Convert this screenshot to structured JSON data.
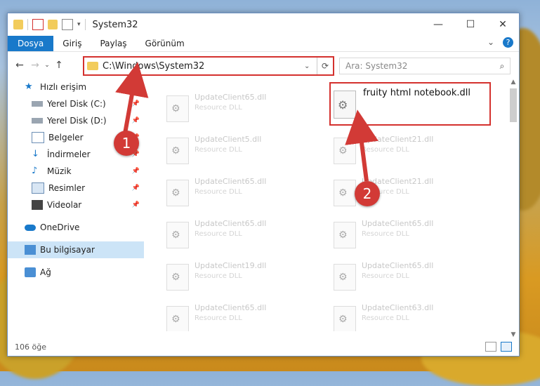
{
  "window": {
    "title": "System32",
    "controls": {
      "minimize": "—",
      "maximize": "☐",
      "close": "✕"
    }
  },
  "ribbon": {
    "file_tab": "Dosya",
    "tabs": [
      "Giriş",
      "Paylaş",
      "Görünüm"
    ],
    "expand": "⌄",
    "help": "?"
  },
  "nav": {
    "back": "←",
    "forward": "→",
    "recent": "⌄",
    "up": "↑",
    "address": "C:\\Windows\\System32",
    "address_drop": "⌄",
    "refresh": "⟳",
    "search_placeholder": "Ara: System32",
    "search_icon": "⌕"
  },
  "sidebar": {
    "items": [
      {
        "label": "Hızlı erişim",
        "icon": "star-icon",
        "pinned": false
      },
      {
        "label": "Yerel Disk (C:)",
        "icon": "drive-icon",
        "pinned": true
      },
      {
        "label": "Yerel Disk (D:)",
        "icon": "drive-icon",
        "pinned": true
      },
      {
        "label": "Belgeler",
        "icon": "document-icon",
        "pinned": true
      },
      {
        "label": "İndirmeler",
        "icon": "download-icon",
        "pinned": true
      },
      {
        "label": "Müzik",
        "icon": "music-icon",
        "pinned": true
      },
      {
        "label": "Resimler",
        "icon": "pictures-icon",
        "pinned": true
      },
      {
        "label": "Videolar",
        "icon": "video-icon",
        "pinned": true
      },
      {
        "label": "OneDrive",
        "icon": "cloud-icon",
        "pinned": false
      },
      {
        "label": "Bu bilgisayar",
        "icon": "computer-icon",
        "pinned": false,
        "selected": true
      },
      {
        "label": "Ağ",
        "icon": "network-icon",
        "pinned": false
      }
    ],
    "pin_glyph": "📌"
  },
  "files": {
    "left_column": [
      {
        "name": "UpdateClient65.dll",
        "type": "Resource DLL"
      },
      {
        "name": "UpdateClient5.dll",
        "type": "Resource DLL"
      },
      {
        "name": "UpdateClient65.dll",
        "type": "Resource DLL"
      },
      {
        "name": "UpdateClient65.dll",
        "type": "Resource DLL"
      },
      {
        "name": "UpdateClient19.dll",
        "type": "Resource DLL"
      },
      {
        "name": "UpdateClient65.dll",
        "type": "Resource DLL"
      }
    ],
    "right_column": [
      {
        "name": "UpdateClient21.dll",
        "type": "Resource DLL"
      },
      {
        "name": "UpdateClient21.dll",
        "type": "Resource DLL"
      },
      {
        "name": "UpdateClient65.dll",
        "type": "Resource DLL"
      },
      {
        "name": "UpdateClient65.dll",
        "type": "Resource DLL"
      },
      {
        "name": "UpdateClient63.dll",
        "type": "Resource DLL"
      }
    ],
    "highlighted": {
      "name": "fruity html notebook.dll"
    }
  },
  "status": {
    "count": "106 öğe"
  },
  "annotations": {
    "step1": "1",
    "step2": "2",
    "color": "#d23a36"
  }
}
